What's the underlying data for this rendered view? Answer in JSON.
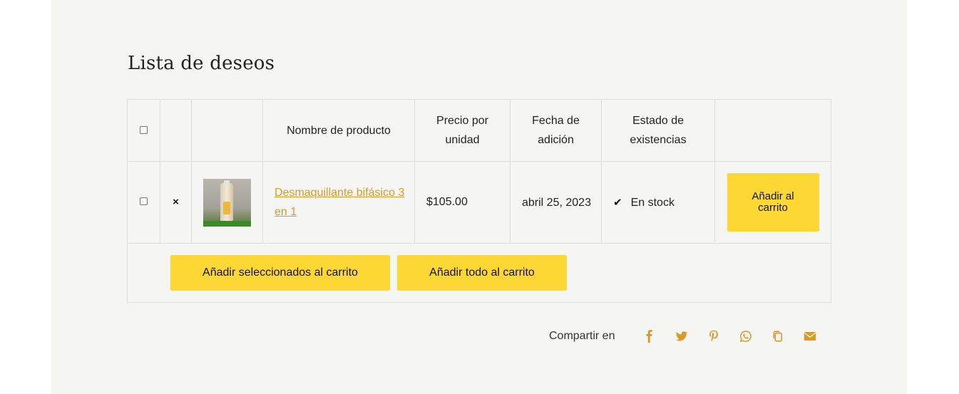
{
  "page": {
    "title": "Lista de deseos"
  },
  "table": {
    "headers": {
      "product_name": "Nombre de producto",
      "unit_price": "Precio por unidad",
      "date_added": "Fecha de adición",
      "stock_status": "Estado de existencias"
    },
    "rows": [
      {
        "remove_symbol": "×",
        "product_name": "Desmaquillante bifásico 3 en 1",
        "price": "$105.00",
        "date_added": "abril 25, 2023",
        "stock_icon": "check-icon",
        "stock": "En stock",
        "add_to_cart": "Añadir al carrito"
      }
    ]
  },
  "actions": {
    "add_selected": "Añadir seleccionados al carrito",
    "add_all": "Añadir todo al carrito"
  },
  "share": {
    "label": "Compartir en",
    "icons": [
      "facebook-icon",
      "twitter-icon",
      "pinterest-icon",
      "whatsapp-icon",
      "copy-link-icon",
      "email-icon"
    ],
    "color": "#d69b2b"
  },
  "colors": {
    "background": "#f5f6f3",
    "button": "#fdd835",
    "link": "#d69b2b"
  }
}
